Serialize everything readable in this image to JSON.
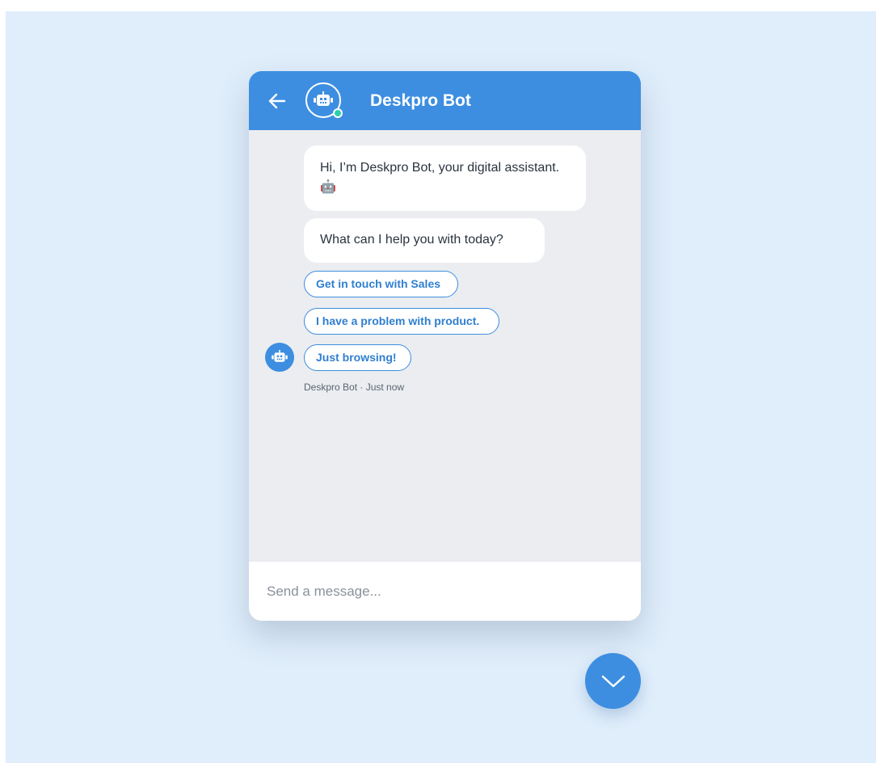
{
  "colors": {
    "page_background": "#e0eefb",
    "header": "#3d8ee0",
    "chat_background": "#ebedf0",
    "chip_border": "#3d8ee0",
    "online_status": "#2ad0b0"
  },
  "header": {
    "title": "Deskpro Bot",
    "back_icon": "arrow-left-icon",
    "avatar_icon": "robot-icon",
    "status": "online"
  },
  "messages": [
    {
      "text": "Hi, I’m Deskpro Bot, your digital assistant. 🤖"
    },
    {
      "text": "What can I help you with today?"
    }
  ],
  "quick_replies": [
    {
      "label": "Get in touch with Sales"
    },
    {
      "label": "I have a problem with product."
    },
    {
      "label": "Just browsing!"
    }
  ],
  "meta": {
    "text": "Deskpro Bot · Just now"
  },
  "composer": {
    "placeholder": "Send a message...",
    "value": ""
  },
  "toggle_button": {
    "icon": "chevron-down-icon"
  }
}
